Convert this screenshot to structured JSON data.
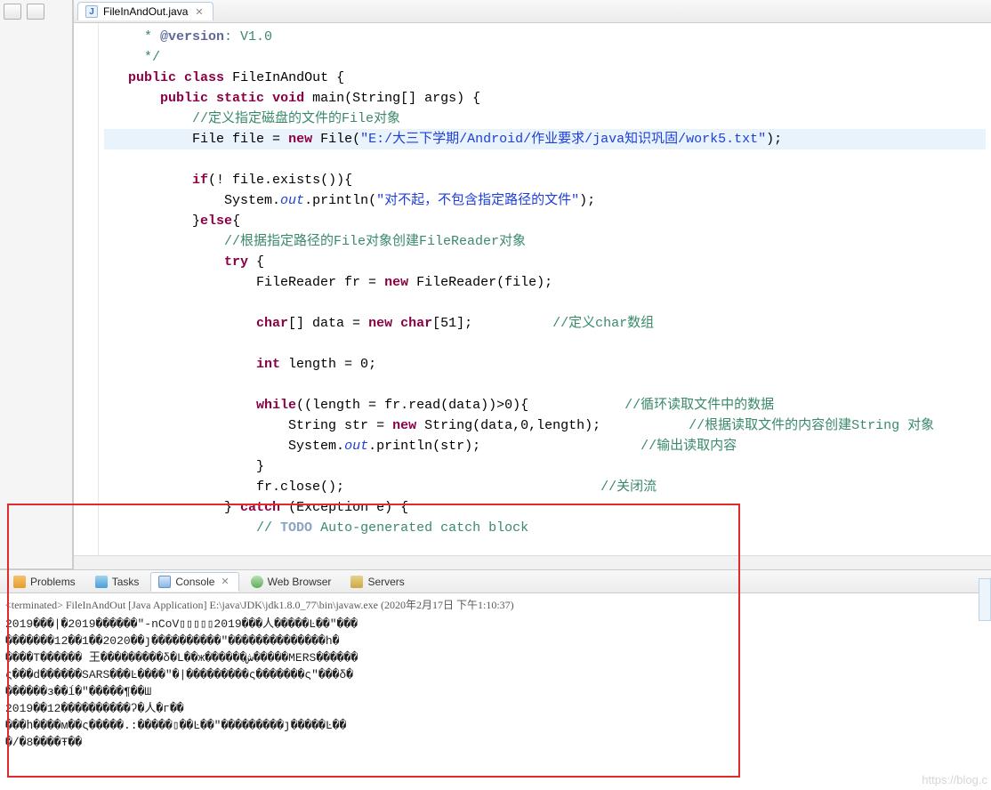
{
  "editor": {
    "tab_label": "FileInAndOut.java",
    "code": {
      "l1a": " * ",
      "l1b": "@version",
      "l1c": ": V1.0",
      "l2": " */",
      "l3a": "public",
      "l3b": "class",
      "l3c": " FileInAndOut {",
      "l4a": "public",
      "l4b": "static",
      "l4c": "void",
      "l4d": " main(String[] args) {",
      "l5": "//定义指定磁盘的文件的File对象",
      "l6a": "File file = ",
      "l6b": "new",
      "l6c": " File(",
      "l6d": "\"E:/大三下学期/Android/作业要求/java知识巩固/work5.txt\"",
      "l6e": ");",
      "l8a": "if",
      "l8b": "(! file.exists()){",
      "l9a": "System.",
      "l9b": "out",
      "l9c": ".println(",
      "l9d": "\"对不起，不包含指定路径的文件\"",
      "l9e": ");",
      "l10a": "}",
      "l10b": "else",
      "l10c": "{",
      "l11": "//根据指定路径的File对象创建FileReader对象",
      "l12a": "try",
      "l12b": " {",
      "l13a": "FileReader fr = ",
      "l13b": "new",
      "l13c": " FileReader(file);",
      "l15a": "char",
      "l15b": "[] data = ",
      "l15c": "new",
      "l15d": "char",
      "l15e": "[51];",
      "l15f": "//定义char数组",
      "l17a": "int",
      "l17b": " length = 0;",
      "l19a": "while",
      "l19b": "((length = fr.read(data))>0){",
      "l19c": "//循环读取文件中的数据",
      "l20a": "String str = ",
      "l20b": "new",
      "l20c": " String(data,0,length);",
      "l20d": "//根据读取文件的内容创建String 对象",
      "l21a": "System.",
      "l21b": "out",
      "l21c": ".println(str);",
      "l21d": "//输出读取内容",
      "l22": "}",
      "l23a": "fr.close();",
      "l23b": "//关闭流",
      "l24a": "} ",
      "l24b": "catch",
      "l24c": " (Exception e) {",
      "l25a": "// ",
      "l25b": "TODO",
      "l25c": " Auto-generated catch block"
    }
  },
  "bottom": {
    "tabs": {
      "problems": "Problems",
      "tasks": "Tasks",
      "console": "Console",
      "browser": "Web Browser",
      "servers": "Servers"
    },
    "console": {
      "header": "<terminated> FileInAndOut [Java Application] E:\\java\\JDK\\jdk1.8.0_77\\bin\\javaw.exe (2020年2月17日 下午1:10:37)",
      "lines": [
        "2019���|�2019������\"-nCoV▯▯▯▯▯2019���人�����Ŀ��\"���",
        "�������12��1��2020��ȷ����������\"��������������h�",
        "����T������ 王���������δ�L��ж������ش�����MERS������",
        "ς���d������SARS���Ŀ����\"�|���������ς�������ς\"���δ�",
        "������з��ĺ�\"�����¶��Ш",
        "2019��12����������ʔ�人�г��",
        "���հ����м��ς�����.:�����▯��Ŀ��\"���������ȷ�����Ŀ��",
        "�/�8����Ŧ��"
      ]
    }
  },
  "watermark": "https://blog.c"
}
